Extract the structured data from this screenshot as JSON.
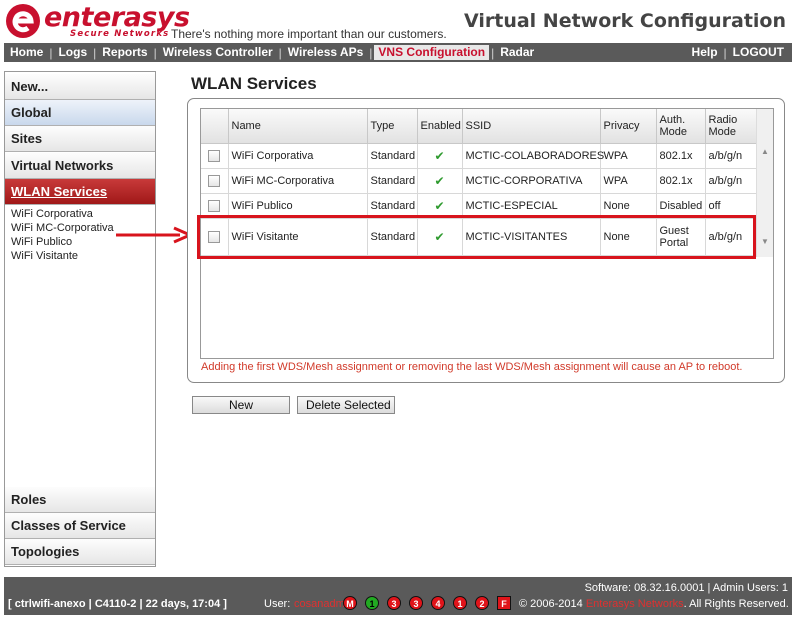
{
  "header": {
    "logo_word": "enterasys",
    "logo_sub": "Secure Networks",
    "tagline": "There's nothing more important than our customers.",
    "page_heading": "Virtual Network Configuration"
  },
  "nav": {
    "items": [
      "Home",
      "Logs",
      "Reports",
      "Wireless Controller",
      "Wireless APs",
      "VNS Configuration",
      "Radar"
    ],
    "active": "VNS Configuration",
    "right": [
      "Help",
      "LOGOUT"
    ]
  },
  "sidebar": {
    "items": [
      "New...",
      "Global",
      "Sites",
      "Virtual Networks",
      "WLAN Services"
    ],
    "selected": "WLAN Services",
    "subitems": [
      "WiFi Corporativa",
      "WiFi MC-Corporativa",
      "WiFi Publico",
      "WiFi Visitante"
    ],
    "bottom_items": [
      "Roles",
      "Classes of Service",
      "Topologies"
    ]
  },
  "main": {
    "title": "WLAN Services",
    "columns": [
      "Name",
      "Type",
      "Enabled",
      "SSID",
      "Privacy",
      "Auth. Mode",
      "Radio Mode"
    ],
    "rows": [
      {
        "name": "WiFi Corporativa",
        "type": "Standard",
        "ssid": "MCTIC-COLABORADORES",
        "privacy": "WPA",
        "auth": "802.1x",
        "radio": "a/b/g/n"
      },
      {
        "name": "WiFi MC-Corporativa",
        "type": "Standard",
        "ssid": "MCTIC-CORPORATIVA",
        "privacy": "WPA",
        "auth": "802.1x",
        "radio": "a/b/g/n"
      },
      {
        "name": "WiFi Publico",
        "type": "Standard",
        "ssid": "MCTIC-ESPECIAL",
        "privacy": "None",
        "auth": "Disabled",
        "radio": "off"
      },
      {
        "name": "WiFi Visitante",
        "type": "Standard",
        "ssid": "MCTIC-VISITANTES",
        "privacy": "None",
        "auth": "Guest Portal",
        "radio": "a/b/g/n"
      }
    ],
    "enabled_glyph": "✔",
    "warning": "Adding the first WDS/Mesh assignment or removing the last WDS/Mesh assignment will cause an AP to reboot.",
    "new_button": "New",
    "delete_button": "Delete Selected"
  },
  "footer": {
    "software": "Software: 08.32.16.0001 | Admin Users: 1",
    "status": "[ ctrlwifi-anexo | C4110-2 | 22 days, 17:04 ]",
    "user_label": "User:",
    "user": "cosanadm",
    "alarms": [
      "M",
      "1",
      "3",
      "3",
      "4",
      "1",
      "2",
      "F"
    ],
    "copyright_prefix": "© 2006-2014",
    "brand": "Enterasys Networks",
    "copyright_suffix": ". All Rights Reserved."
  }
}
